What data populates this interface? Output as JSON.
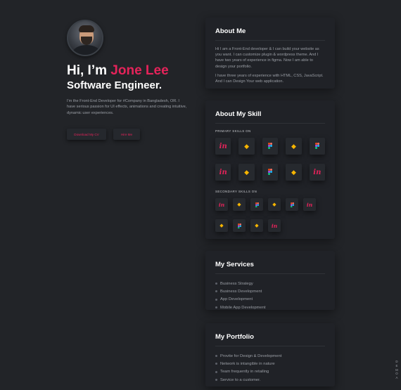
{
  "hero": {
    "greeting": "Hi, I’m ",
    "name": "Jone Lee",
    "role": "Software Engineer.",
    "intro": "I'm the Front-End Developer for #Company in Bangladesh, OR. I have serious passion for UI effects, animations and creating intuitive, dynamic user experiences.",
    "download_label": "Download My CV",
    "hire_label": "Hire Me"
  },
  "about": {
    "title": "About Me",
    "para1": "Hi I am a Front-End developer & I can build your website as you want. I can customize plugin & wordpress theme. And I have two years of experience in figma. Now I am able to design your portfolio.",
    "para2": "I have three years of experience with HTML, CSS, JavaScript. And I can Design Your web application."
  },
  "skills": {
    "title": "About My Skill",
    "primary_label": "PRIMARY SKILLS ON",
    "secondary_label": "SECONDARY SKILLS ON",
    "in_glyph": "in",
    "sketch_glyph": "◆",
    "primary_rows": [
      [
        "invision-icon",
        "sketch-icon",
        "figma-icon",
        "sketch-icon",
        "figma-icon"
      ],
      [
        "invision-icon",
        "sketch-icon",
        "figma-icon",
        "sketch-icon",
        "invision-icon"
      ]
    ],
    "secondary_rows": [
      [
        "invision-icon",
        "sketch-icon",
        "figma-icon",
        "sketch-icon",
        "figma-icon",
        "invision-icon"
      ],
      [
        "sketch-icon",
        "figma-icon",
        "sketch-icon",
        "invision-icon"
      ]
    ]
  },
  "services": {
    "title": "My Services",
    "items": [
      "Business Strategy",
      "Business Development",
      "App Development",
      "Mobile App Development"
    ]
  },
  "portfolio": {
    "title": "My Portfolio",
    "items": [
      "Provite for Design & Development",
      "Network is intangible in nature",
      "Team frequently in retailing",
      "Service to a customer."
    ]
  },
  "side_text": [
    "D",
    "E",
    "M",
    "O",
    "A"
  ],
  "colors": {
    "accent": "#e5235a",
    "background": "#222428",
    "card": "#202227",
    "sketch": "#f7b500"
  }
}
